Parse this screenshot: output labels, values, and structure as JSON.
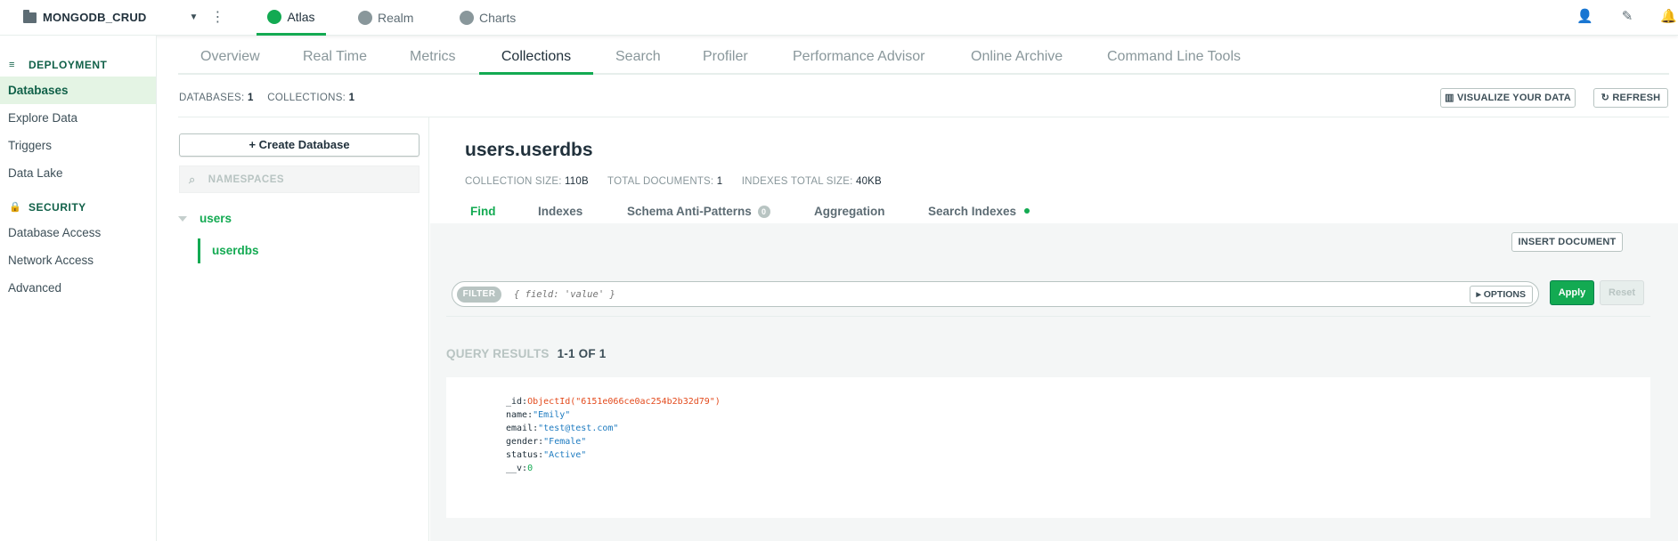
{
  "topbar": {
    "project_name": "MONGODB_CRUD",
    "apps": [
      {
        "label": "Atlas"
      },
      {
        "label": "Realm"
      },
      {
        "label": "Charts"
      }
    ]
  },
  "sidebar": {
    "deployment_header": "DEPLOYMENT",
    "deployment_items": [
      {
        "label": "Databases"
      },
      {
        "label": "Explore Data"
      },
      {
        "label": "Triggers"
      },
      {
        "label": "Data Lake"
      }
    ],
    "security_header": "SECURITY",
    "security_items": [
      {
        "label": "Database Access"
      },
      {
        "label": "Network Access"
      },
      {
        "label": "Advanced"
      }
    ]
  },
  "subtabs": [
    {
      "label": "Overview"
    },
    {
      "label": "Real Time"
    },
    {
      "label": "Metrics"
    },
    {
      "label": "Collections"
    },
    {
      "label": "Search"
    },
    {
      "label": "Profiler"
    },
    {
      "label": "Performance Advisor"
    },
    {
      "label": "Online Archive"
    },
    {
      "label": "Command Line Tools"
    }
  ],
  "counts": {
    "databases_label": "DATABASES:",
    "databases_value": "1",
    "collections_label": "COLLECTIONS:",
    "collections_value": "1"
  },
  "actions": {
    "visualize": "VISUALIZE YOUR DATA",
    "refresh": "REFRESH"
  },
  "dbpanel": {
    "create_button": "Create Database",
    "namespace_placeholder": "NAMESPACES",
    "database": "users",
    "collection": "userdbs"
  },
  "collection": {
    "title": "users.userdbs",
    "size_label": "COLLECTION SIZE:",
    "size_value": "110B",
    "docs_label": "TOTAL DOCUMENTS:",
    "docs_value": "1",
    "index_label": "INDEXES TOTAL SIZE:",
    "index_value": "40KB",
    "tabs": [
      {
        "label": "Find"
      },
      {
        "label": "Indexes"
      },
      {
        "label": "Schema Anti-Patterns"
      },
      {
        "label": "Aggregation"
      },
      {
        "label": "Search Indexes"
      }
    ],
    "anti_pattern_count": "0"
  },
  "query": {
    "insert_button": "INSERT DOCUMENT",
    "filter_pill": "FILTER",
    "filter_placeholder": "{ field: 'value' }",
    "options_button": "OPTIONS",
    "apply_button": "Apply",
    "reset_button": "Reset",
    "results_label": "QUERY RESULTS",
    "results_range": "1-1 OF 1"
  },
  "document": {
    "fields": [
      {
        "key": "_id:",
        "value": "ObjectId(\"6151e066ce0ac254b2b32d79\")",
        "kind": "oid"
      },
      {
        "key": "name:",
        "value": "\"Emily\"",
        "kind": "str"
      },
      {
        "key": "email:",
        "value": "\"test@test.com\"",
        "kind": "str"
      },
      {
        "key": "gender:",
        "value": "\"Female\"",
        "kind": "str"
      },
      {
        "key": "status:",
        "value": "\"Active\"",
        "kind": "str"
      },
      {
        "key": "__v:",
        "value": "0",
        "kind": "num"
      }
    ]
  }
}
